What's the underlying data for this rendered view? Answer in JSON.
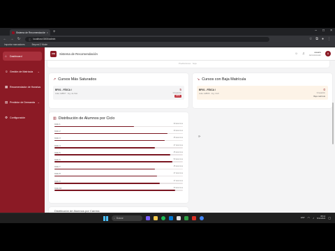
{
  "browser": {
    "tab_title": "Sistema de Recomendación · UNI",
    "tab_close": "×",
    "new_tab": "+",
    "window_buttons": [
      "–",
      "□",
      "×"
    ],
    "url": "localhost:3000/admin",
    "bookmarks": [
      "Importar marcadores",
      "Beyond 2 Mode"
    ]
  },
  "app": {
    "logo_text": "UNI",
    "title": "Sistema de Recomendación",
    "user_name": "usuario",
    "user_role": "Administrador",
    "avatar_initial": "A"
  },
  "sidebar": {
    "items": [
      {
        "label": "Dashboard",
        "icon": "home-icon",
        "active": true
      },
      {
        "label": "Gestión de Matrícula",
        "icon": "users-icon",
        "chevron": true
      },
      {
        "label": "Recomendador de Horarios",
        "icon": "calendar-icon",
        "chevron": true
      },
      {
        "label": "Predictor de Demanda",
        "icon": "chart-icon",
        "chevron": true
      },
      {
        "label": "Configuración",
        "icon": "gear-icon"
      }
    ]
  },
  "main": {
    "top_fragment": "Predicciones · hoja",
    "saturated": {
      "title": "Cursos Más Saturados",
      "course_code": "BFI01 - FÍSICA I",
      "course_sub": "Aula: A2B07 · Ing. de Sist.",
      "count": "5",
      "count_label": "Ocupación",
      "badge": "100%",
      "color": "#c23842"
    },
    "low": {
      "title": "Cursos con Baja Matrícula",
      "course_code": "BFI01 - FÍSICA I",
      "course_sub": "Aula: A2B06 · Ing. Civil",
      "count": "0",
      "count_label": "Ocupación",
      "badge": "Baja matrícula",
      "color": "#fdf3e7"
    },
    "distribution": {
      "title": "Distribución de Alumnos por Ciclo",
      "rows": [
        {
          "label": "Ciclo 1",
          "value": "30 alumnos",
          "fill": 0.62
        },
        {
          "label": "Ciclo 2",
          "value": "40 alumnos",
          "fill": 0.88
        },
        {
          "label": "Ciclo 3",
          "value": "45 alumnos",
          "fill": 0.86
        },
        {
          "label": "Ciclo 4",
          "value": "47 alumnos",
          "fill": 0.78
        },
        {
          "label": "Ciclo 5",
          "value": "45 alumnos",
          "fill": 0.9
        },
        {
          "label": "Ciclo 6",
          "value": "50 alumnos",
          "fill": 0.92
        },
        {
          "label": "Ciclo 7",
          "value": "45 alumnos",
          "fill": 0.78
        },
        {
          "label": "Ciclo 8",
          "value": "47 alumnos",
          "fill": 0.8
        },
        {
          "label": "Ciclo 9",
          "value": "47 alumnos",
          "fill": 0.82
        },
        {
          "label": "Ciclo 10",
          "value": "30 alumnos",
          "fill": 0.94
        }
      ]
    },
    "loading_glyph": "⟳",
    "bottom_fragment": "Distribución de Alumnos por Carrera"
  },
  "taskbar": {
    "search_placeholder": "Buscar",
    "time": "08:14",
    "date": "5/11/2024",
    "lang": "ESP"
  }
}
